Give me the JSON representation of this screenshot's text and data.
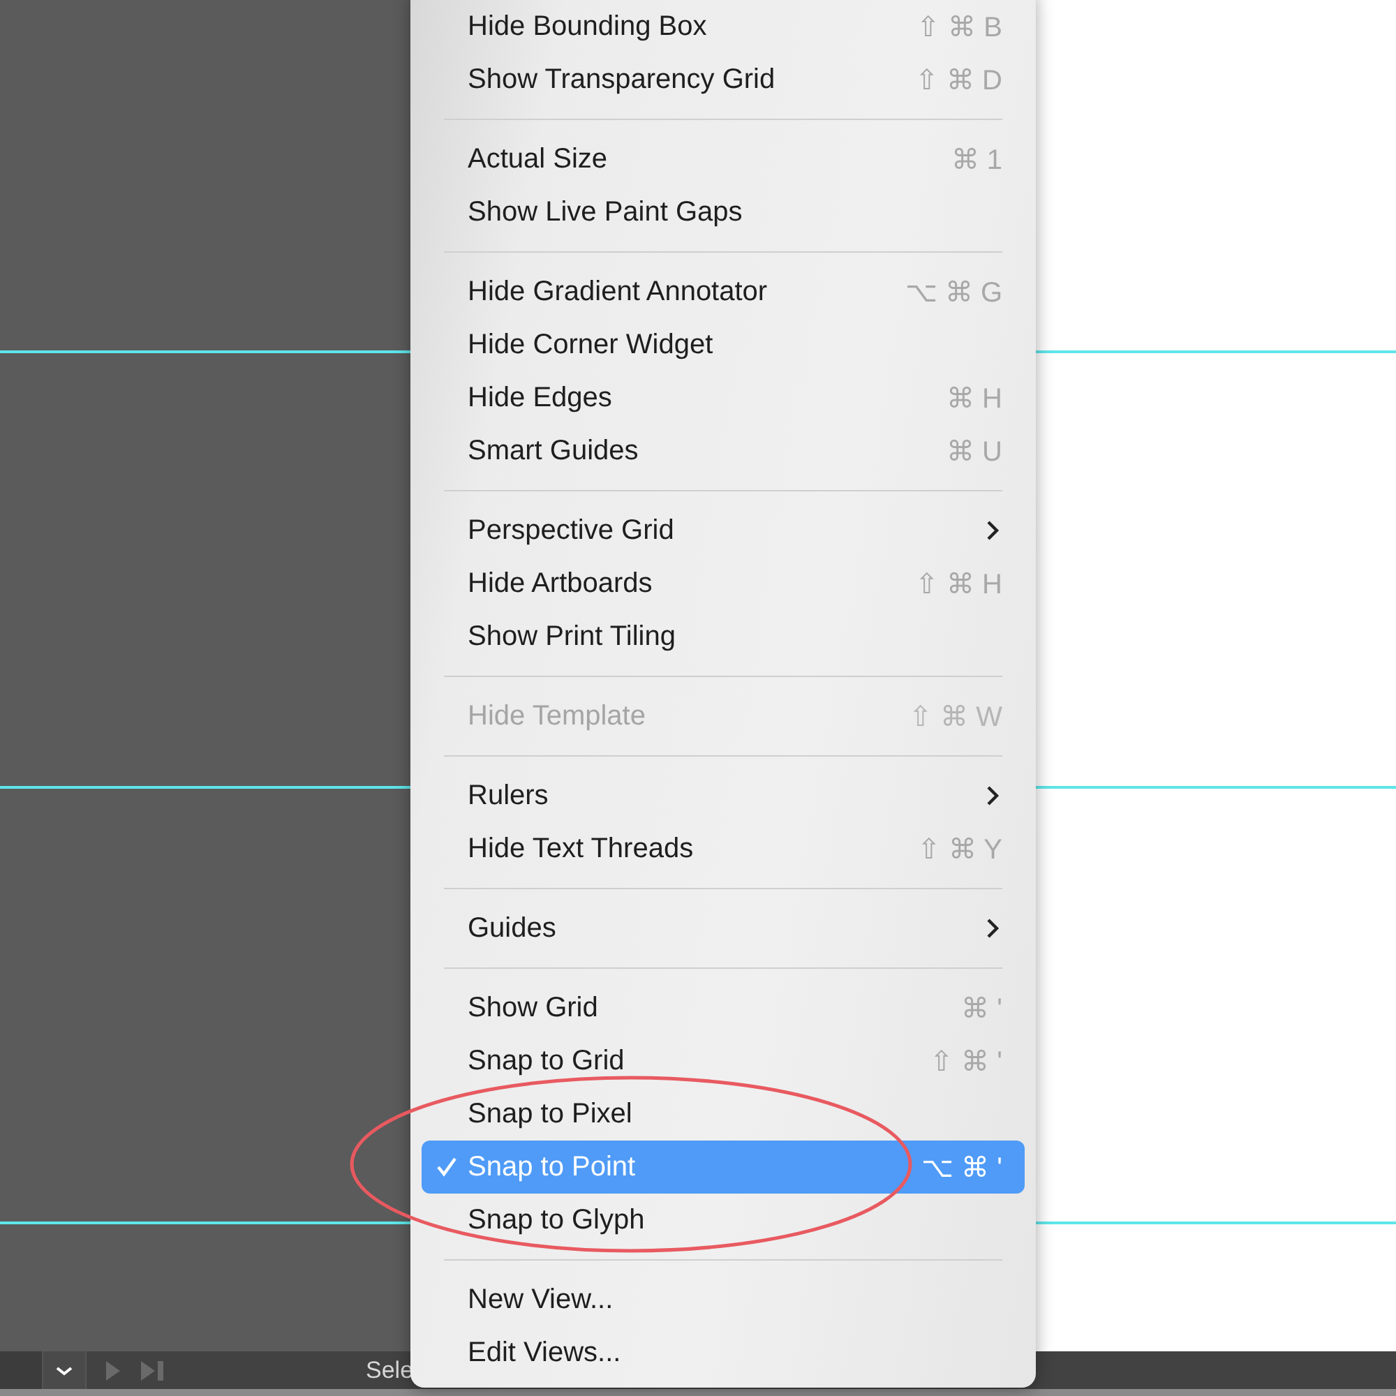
{
  "menu": {
    "groups": [
      [
        {
          "label": "Hide Bounding Box",
          "kind": "shortcut",
          "shortcut": "⇧ ⌘ B",
          "disabled": false,
          "selected": false
        },
        {
          "label": "Show Transparency Grid",
          "kind": "shortcut",
          "shortcut": "⇧ ⌘ D",
          "disabled": false,
          "selected": false
        }
      ],
      [
        {
          "label": "Actual Size",
          "kind": "shortcut",
          "shortcut": "⌘ 1",
          "disabled": false,
          "selected": false
        },
        {
          "label": "Show Live Paint Gaps",
          "kind": "plain",
          "disabled": false,
          "selected": false
        }
      ],
      [
        {
          "label": "Hide Gradient Annotator",
          "kind": "shortcut",
          "shortcut": "⌥ ⌘ G",
          "disabled": false,
          "selected": false
        },
        {
          "label": "Hide Corner Widget",
          "kind": "plain",
          "disabled": false,
          "selected": false
        },
        {
          "label": "Hide Edges",
          "kind": "shortcut",
          "shortcut": "⌘ H",
          "disabled": false,
          "selected": false
        },
        {
          "label": "Smart Guides",
          "kind": "shortcut",
          "shortcut": "⌘ U",
          "disabled": false,
          "selected": false
        }
      ],
      [
        {
          "label": "Perspective Grid",
          "kind": "submenu",
          "disabled": false,
          "selected": false
        },
        {
          "label": "Hide Artboards",
          "kind": "shortcut",
          "shortcut": "⇧ ⌘ H",
          "disabled": false,
          "selected": false
        },
        {
          "label": "Show Print Tiling",
          "kind": "plain",
          "disabled": false,
          "selected": false
        }
      ],
      [
        {
          "label": "Hide Template",
          "kind": "shortcut",
          "shortcut": "⇧ ⌘ W",
          "disabled": true,
          "selected": false
        }
      ],
      [
        {
          "label": "Rulers",
          "kind": "submenu",
          "disabled": false,
          "selected": false
        },
        {
          "label": "Hide Text Threads",
          "kind": "shortcut",
          "shortcut": "⇧ ⌘ Y",
          "disabled": false,
          "selected": false
        }
      ],
      [
        {
          "label": "Guides",
          "kind": "submenu",
          "disabled": false,
          "selected": false
        }
      ],
      [
        {
          "label": "Show Grid",
          "kind": "shortcut",
          "shortcut": "⌘ '",
          "disabled": false,
          "selected": false
        },
        {
          "label": "Snap to Grid",
          "kind": "shortcut",
          "shortcut": "⇧ ⌘ '",
          "disabled": false,
          "selected": false
        },
        {
          "label": "Snap to Pixel",
          "kind": "plain",
          "disabled": false,
          "selected": false
        },
        {
          "label": "Snap to Point",
          "kind": "shortcut",
          "shortcut": "⌥ ⌘ '",
          "disabled": false,
          "selected": true,
          "checked": true
        },
        {
          "label": "Snap to Glyph",
          "kind": "plain",
          "disabled": false,
          "selected": false
        }
      ],
      [
        {
          "label": "New View...",
          "kind": "plain",
          "disabled": false,
          "selected": false
        },
        {
          "label": "Edit Views...",
          "kind": "plain",
          "disabled": false,
          "selected": false
        }
      ]
    ]
  },
  "status_bar": {
    "mode": "Sele"
  }
}
